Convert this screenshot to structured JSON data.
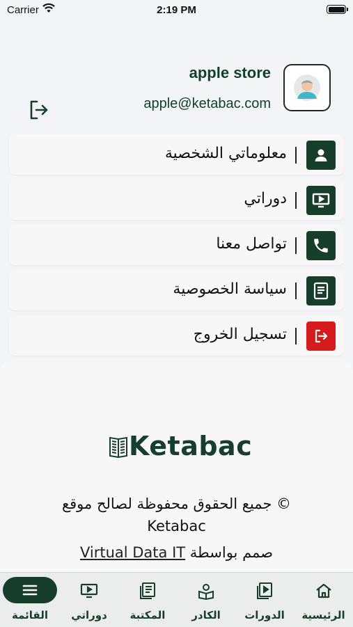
{
  "status": {
    "carrier": "Carrier",
    "time": "2:19 PM"
  },
  "profile": {
    "name": "apple store",
    "email": "apple@ketabac.com"
  },
  "menu": {
    "items": [
      {
        "label": "معلوماتي الشخصية",
        "icon": "person-icon"
      },
      {
        "label": "دوراتي",
        "icon": "tv-icon"
      },
      {
        "label": "تواصل معنا",
        "icon": "phone-icon"
      },
      {
        "label": "سياسة الخصوصية",
        "icon": "book-icon"
      },
      {
        "label": "تسجيل الخروج",
        "icon": "logout-icon"
      }
    ]
  },
  "footer": {
    "brand": "Ketabac",
    "copyright_line1": "© جميع الحقوق محفوظة لصالح موقع",
    "copyright_line2": "Ketabac",
    "designed_by": "صمم بواسطة",
    "designer_link": "Virtual Data IT"
  },
  "tabs": [
    {
      "label": "القائمة",
      "icon": "menu-icon",
      "active": true
    },
    {
      "label": "دوراتي",
      "icon": "tv-icon"
    },
    {
      "label": "المكتبة",
      "icon": "library-icon"
    },
    {
      "label": "الكادر",
      "icon": "staff-icon"
    },
    {
      "label": "الدورات",
      "icon": "courses-icon"
    },
    {
      "label": "الرئيسية",
      "icon": "home-icon"
    }
  ],
  "colors": {
    "primary": "#173d2c",
    "danger": "#d51b1b"
  }
}
